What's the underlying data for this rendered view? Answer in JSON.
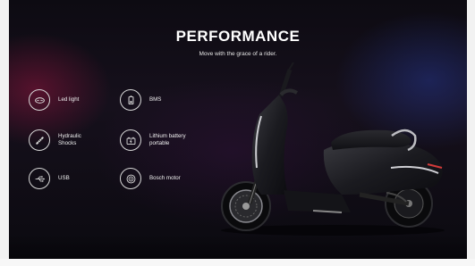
{
  "section": {
    "title": "PERFORMANCE",
    "subtitle": "Move with the grace of a rider."
  },
  "features": [
    {
      "label": "Led light",
      "icon": "led-light-icon"
    },
    {
      "label": "BMS",
      "icon": "bms-icon"
    },
    {
      "label": "Hydraulic\nShocks",
      "icon": "hydraulic-shocks-icon"
    },
    {
      "label": "Lithium battery\nportable",
      "icon": "lithium-battery-icon"
    },
    {
      "label": "USB",
      "icon": "usb-icon"
    },
    {
      "label": "Bosch motor",
      "icon": "bosch-motor-icon"
    }
  ],
  "colors": {
    "accent_magenta": "#8c143c",
    "accent_blue": "#283ca0",
    "background": "#0d0b12"
  }
}
